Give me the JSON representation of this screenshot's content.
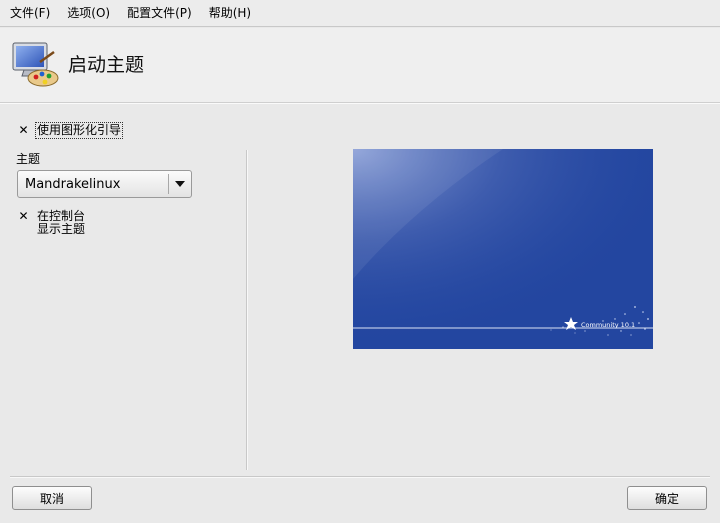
{
  "menubar": {
    "items": [
      {
        "label": "文件(F)"
      },
      {
        "label": "选项(O)"
      },
      {
        "label": "配置文件(P)"
      },
      {
        "label": "帮助(H)"
      }
    ]
  },
  "header": {
    "title": "启动主题"
  },
  "options": {
    "use_graphical_boot": {
      "label": "使用图形化引导",
      "checked": true
    },
    "theme_label": "主题",
    "theme_select": {
      "value": "Mandrakelinux"
    },
    "show_theme_console": {
      "label_line1": "在控制台",
      "label_line2": "显示主题",
      "checked": true
    }
  },
  "preview": {
    "brand_text": "Community 10.1"
  },
  "buttons": {
    "cancel": "取消",
    "ok": "确定"
  },
  "icons": {
    "app": "monitor-palette-icon",
    "checkbox_mark": "✕",
    "combo_arrow": "chevron-down-icon"
  },
  "colors": {
    "preview_bg": "#2346a0"
  }
}
